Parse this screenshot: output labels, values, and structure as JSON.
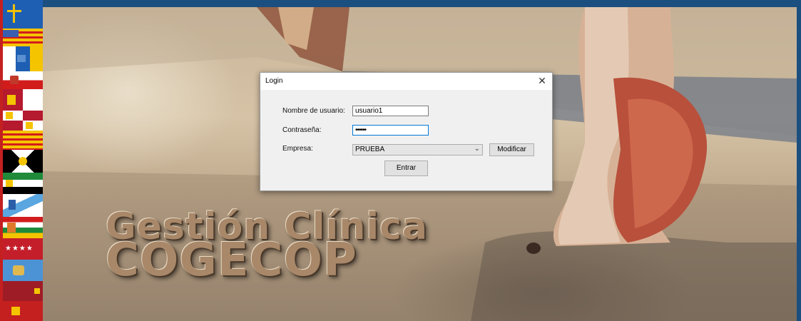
{
  "background": {
    "logo_line1": "Gestión Clínica",
    "logo_line2": "COGECOP"
  },
  "flags": [
    {
      "name": "asturias-flag",
      "colors": [
        "#1e5fb3",
        "#f2c200"
      ]
    },
    {
      "name": "aragon-flag",
      "colors": [
        "#f5c400",
        "#d21c1c"
      ]
    },
    {
      "name": "canarias-flag",
      "colors": [
        "#ffffff",
        "#1e5fb3",
        "#f5c400"
      ]
    },
    {
      "name": "cantabria-flag",
      "colors": [
        "#ffffff",
        "#d21c1c"
      ]
    },
    {
      "name": "castilla-la-mancha-flag",
      "colors": [
        "#b51a2e",
        "#ffffff"
      ]
    },
    {
      "name": "castilla-leon-flag",
      "colors": [
        "#b51a2e",
        "#f5c400"
      ]
    },
    {
      "name": "cataluna-flag",
      "colors": [
        "#f5c400",
        "#d21c1c"
      ]
    },
    {
      "name": "ceuta-flag",
      "colors": [
        "#000000",
        "#ffffff"
      ]
    },
    {
      "name": "extremadura-flag",
      "colors": [
        "#1e8a3a",
        "#ffffff",
        "#000000"
      ]
    },
    {
      "name": "galicia-flag",
      "colors": [
        "#ffffff",
        "#5aa6e0"
      ]
    },
    {
      "name": "la-rioja-flag",
      "colors": [
        "#d21c1c",
        "#ffffff",
        "#1e8a3a",
        "#f5c400"
      ]
    },
    {
      "name": "madrid-flag",
      "colors": [
        "#c41e2a",
        "#ffffff"
      ]
    },
    {
      "name": "melilla-flag",
      "colors": [
        "#4c93d6"
      ]
    },
    {
      "name": "murcia-flag",
      "colors": [
        "#9e1c26",
        "#f5c400"
      ]
    },
    {
      "name": "navarra-flag",
      "colors": [
        "#c42020",
        "#f5c400"
      ]
    }
  ],
  "dialog": {
    "title": "Login",
    "close_icon": "close-icon",
    "username_label": "Nombre de usuario:",
    "username_value": "usuario1",
    "password_label": "Contraseña:",
    "password_value": "••••••",
    "company_label": "Empresa:",
    "company_value": "PRUEBA",
    "modify_label": "Modificar",
    "enter_label": "Entrar"
  }
}
